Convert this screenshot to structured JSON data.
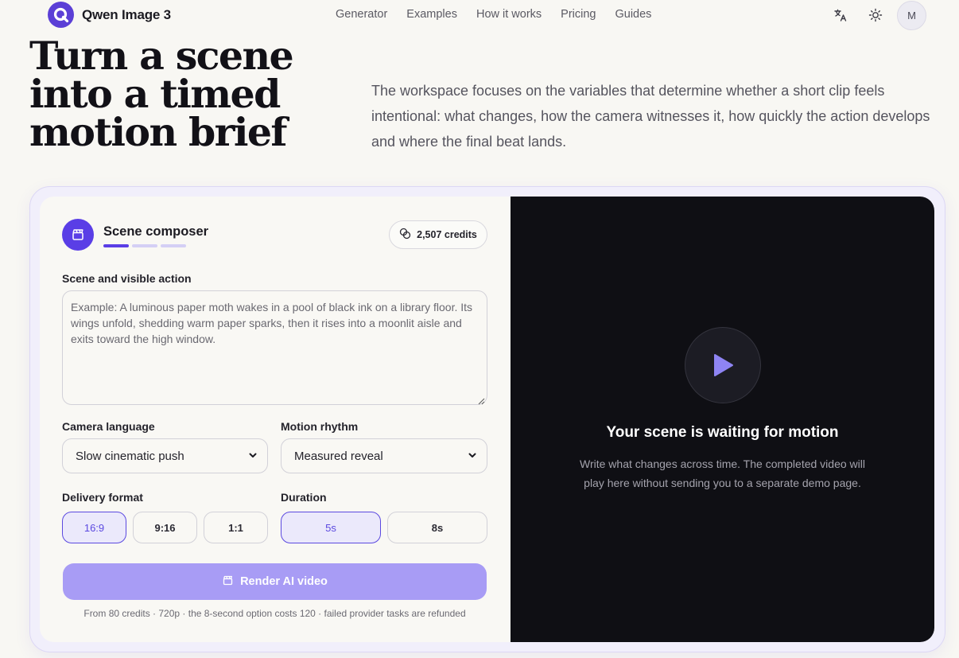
{
  "header": {
    "brand": "Qwen Image 3",
    "nav": [
      "Generator",
      "Examples",
      "How it works",
      "Pricing",
      "Guides"
    ],
    "icons": [
      "translate-icon",
      "sun-icon"
    ],
    "avatar_initial": "M"
  },
  "hero": {
    "title": "Turn a scene into a timed motion brief",
    "description": "The workspace focuses on the variables that determine whether a short clip feels intentional: what changes, how the camera witnesses it, how quickly the action develops and where the final beat lands."
  },
  "composer": {
    "title": "Scene composer",
    "steps_total": 3,
    "steps_active": 1,
    "credits": "2,507 credits",
    "scene_label": "Scene and visible action",
    "scene_placeholder": "Example: A luminous paper moth wakes in a pool of black ink on a library floor. Its wings unfold, shedding warm paper sparks, then it rises into a moonlit aisle and exits toward the high window.",
    "scene_value": "",
    "camera_label": "Camera language",
    "camera_value": "Slow cinematic push",
    "rhythm_label": "Motion rhythm",
    "rhythm_value": "Measured reveal",
    "format_label": "Delivery format",
    "formats": [
      {
        "label": "16:9",
        "selected": true
      },
      {
        "label": "9:16",
        "selected": false
      },
      {
        "label": "1:1",
        "selected": false
      }
    ],
    "duration_label": "Duration",
    "durations": [
      {
        "label": "5s",
        "selected": true
      },
      {
        "label": "8s",
        "selected": false
      }
    ],
    "render_label": "Render AI video",
    "footnote": "From 80 credits · 720p · the 8-second option costs 120 · failed provider tasks are refunded"
  },
  "preview": {
    "title": "Your scene is waiting for motion",
    "description": "Write what changes across time. The completed video will play here without sending you to a separate demo page."
  },
  "colors": {
    "accent": "#5a3ee6",
    "accent_soft": "#a89cf5",
    "preview_bg": "#0f0f14",
    "page_bg": "#f8f7f3"
  }
}
